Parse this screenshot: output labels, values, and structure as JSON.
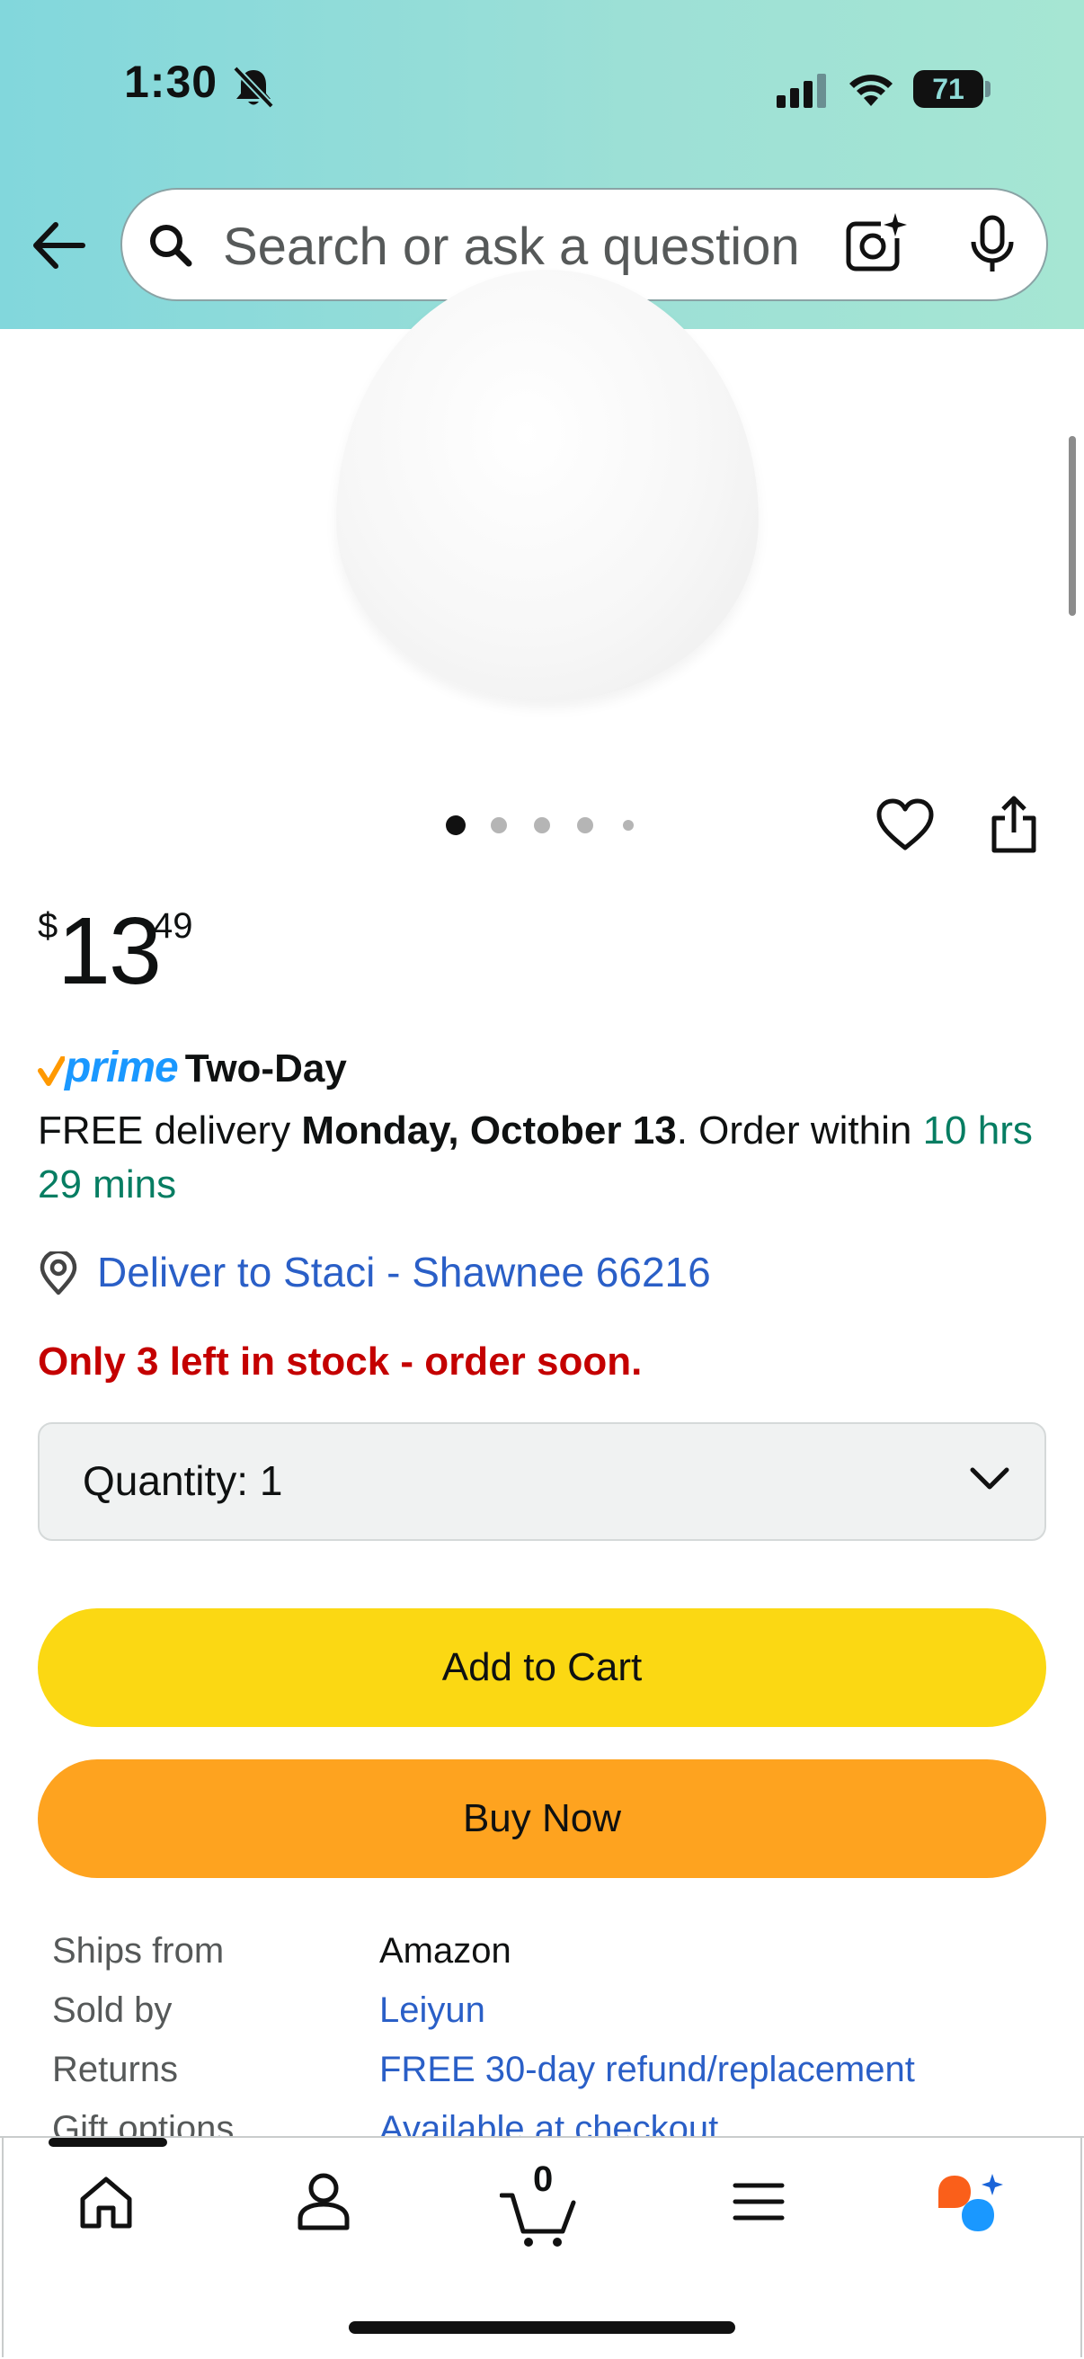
{
  "status_bar": {
    "time": "1:30",
    "battery_level": "71"
  },
  "search": {
    "placeholder": "Search or ask a question"
  },
  "product": {
    "image_pages": 5,
    "current_image": 1,
    "price": {
      "currency_symbol": "$",
      "whole": "13",
      "fraction": "49"
    },
    "prime": {
      "label": "prime",
      "speed": "Two-Day"
    },
    "delivery": {
      "prefix": "FREE delivery ",
      "date": "Monday, October 13",
      "middle": ". Order within ",
      "countdown": "10 hrs 29 mins"
    },
    "deliver_to": "Deliver to Staci - Shawnee 66216",
    "stock_message": "Only 3 left in stock - order soon.",
    "quantity_label": "Quantity:",
    "quantity_value": "1"
  },
  "buttons": {
    "add_to_cart": "Add to Cart",
    "buy_now": "Buy Now"
  },
  "details": [
    {
      "label": "Ships from",
      "value": "Amazon",
      "link": false
    },
    {
      "label": "Sold by",
      "value": "Leiyun",
      "link": true
    },
    {
      "label": "Returns",
      "value": "FREE 30-day refund/replacement",
      "link": true
    },
    {
      "label": "Gift options",
      "value": "Available at checkout",
      "link": true
    }
  ],
  "bottom_nav": {
    "items": [
      "home-icon",
      "account-icon",
      "cart-icon",
      "menu-icon",
      "rufus-icon"
    ],
    "cart_count": "0"
  },
  "colors": {
    "add_to_cart": "#fbd813",
    "buy_now": "#fea31f",
    "link": "#2a5fc7",
    "stock_warning": "#c40000",
    "countdown_green": "#067d62",
    "prime_blue": "#1a98ff"
  }
}
